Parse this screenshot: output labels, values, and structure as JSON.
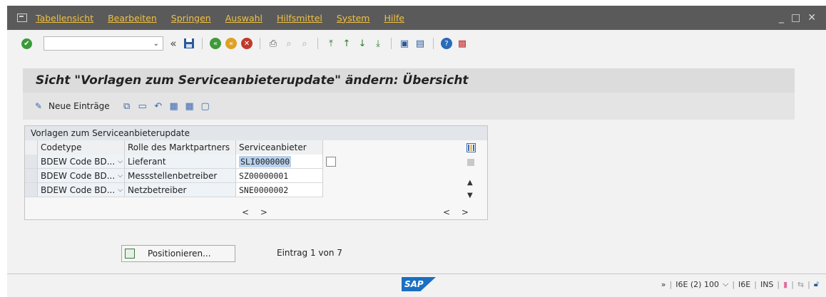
{
  "menu": {
    "items": [
      "Tabellensicht",
      "Bearbeiten",
      "Springen",
      "Auswahl",
      "Hilfsmittel",
      "System",
      "Hilfe"
    ],
    "window_controls": [
      "_",
      "□",
      "✕"
    ]
  },
  "toolbar": {
    "command_field_value": "",
    "command_dropdown": "⌄"
  },
  "title": "Sicht \"Vorlagen zum Serviceanbieterupdate\" ändern: Übersicht",
  "app_toolbar": {
    "new_entries_label": "Neue Einträge"
  },
  "table": {
    "title": "Vorlagen zum Serviceanbieterupdate",
    "columns": [
      "Codetype",
      "Rolle des Marktpartners",
      "Serviceanbieter"
    ],
    "rows": [
      {
        "codetype": "BDEW Code BD...",
        "rolle": "Lieferant",
        "anbieter": "SLI0000000"
      },
      {
        "codetype": "BDEW Code BD...",
        "rolle": "Messstellenbetreiber",
        "anbieter": "SZ00000001"
      },
      {
        "codetype": "BDEW Code BD...",
        "rolle": "Netzbetreiber",
        "anbieter": "SNE0000002"
      }
    ],
    "hscroll": "< >"
  },
  "position_button_label": "Positionieren...",
  "entry_info": "Eintrag 1 von 7",
  "status": {
    "expand": "»",
    "system": "I6E (2) 100",
    "server": "I6E",
    "mode": "INS"
  },
  "sap_logo": "SAP"
}
